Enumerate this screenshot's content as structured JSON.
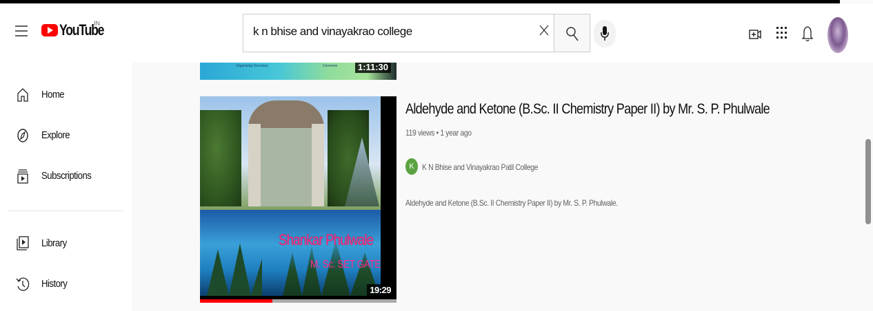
{
  "header": {
    "logo_text": "YouTube",
    "country_code": "IN",
    "search": {
      "value": "k n bhise and vinayakrao college",
      "placeholder": "Search"
    },
    "icons": [
      "menu-icon",
      "clear-icon",
      "search-icon",
      "mic-icon",
      "create-icon",
      "apps-icon",
      "bell-icon"
    ]
  },
  "sidebar": {
    "items": [
      {
        "label": "Home",
        "icon": "home-icon"
      },
      {
        "label": "Explore",
        "icon": "compass-icon"
      },
      {
        "label": "Subscriptions",
        "icon": "subscriptions-icon"
      },
      {
        "label": "Library",
        "icon": "library-icon"
      },
      {
        "label": "History",
        "icon": "history-icon"
      }
    ]
  },
  "results": {
    "prev": {
      "thumb_text_1": "Organising Secretary",
      "thumb_text_2": "Convener",
      "duration": "1:11:30"
    },
    "video": {
      "title": "Aldehyde and Ketone (B.Sc. II Chemistry Paper II) by Mr. S. P. Phulwale",
      "views": "119 views",
      "age": "1 year ago",
      "channel_initial": "K",
      "channel": "K N Bhise and Vinayakrao Patil College",
      "description": "Aldehyde and Ketone (B.Sc. II Chemistry Paper II) by Mr. S. P. Phulwale.",
      "thumb_name": "Shankar Phulwale",
      "thumb_qual": "M. Sc. SET GATE",
      "duration": "19:29",
      "watched_fraction": 0.37
    }
  },
  "colors": {
    "accent": "#ff0000",
    "channel_avatar": "#5ba341"
  }
}
